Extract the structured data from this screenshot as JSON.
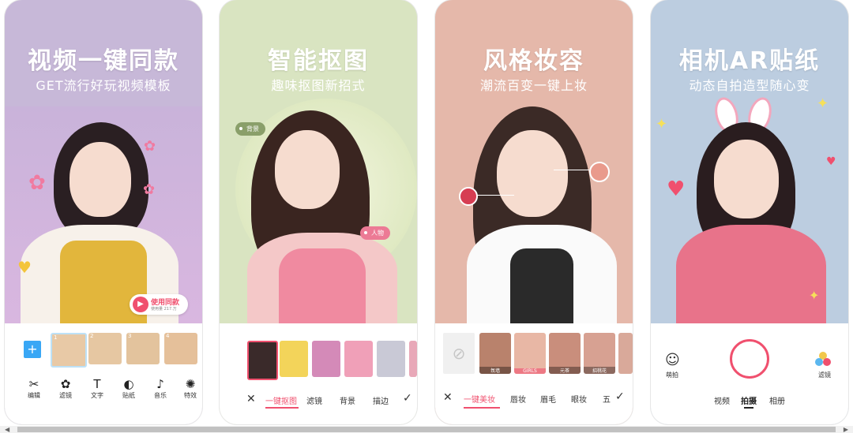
{
  "cards": [
    {
      "title": "视频一键同款",
      "subtitle": "GET流行好玩视频模板",
      "badge_main": "使用同款",
      "badge_sub": "使用量 217.万",
      "thumb_numbers": [
        "1",
        "2",
        "3",
        "4"
      ],
      "tools": [
        {
          "label": "编辑",
          "icon": "✂"
        },
        {
          "label": "滤镜",
          "icon": "✿"
        },
        {
          "label": "文字",
          "icon": "T"
        },
        {
          "label": "贴纸",
          "icon": "◐"
        },
        {
          "label": "音乐",
          "icon": "♪"
        },
        {
          "label": "特效",
          "icon": "✺"
        }
      ]
    },
    {
      "title": "智能抠图",
      "subtitle": "趣味抠图新招式",
      "tag_left": "背景",
      "tag_right": "人物",
      "tabs": [
        "一键抠图",
        "滤镜",
        "背景",
        "描边"
      ]
    },
    {
      "title": "风格妆容",
      "subtitle": "潮流百变一键上妆",
      "styles": [
        "氛墙",
        "GIRLS",
        "元茶",
        "招桃花"
      ],
      "tabs": [
        "一键美妆",
        "唇妆",
        "眉毛",
        "眼妆",
        "五"
      ]
    },
    {
      "title": "相机AR贴纸",
      "subtitle": "动态自拍造型随心变",
      "left_label": "萌拍",
      "right_label": "滤镜",
      "modes": [
        "视频",
        "拍摄",
        "相册"
      ]
    }
  ],
  "colors": {
    "accent_pink": "#f0506e",
    "card1": "#c7b8d8",
    "card2": "#d9e4c1",
    "card3": "#e5b8aa",
    "card4": "#bccde0"
  }
}
